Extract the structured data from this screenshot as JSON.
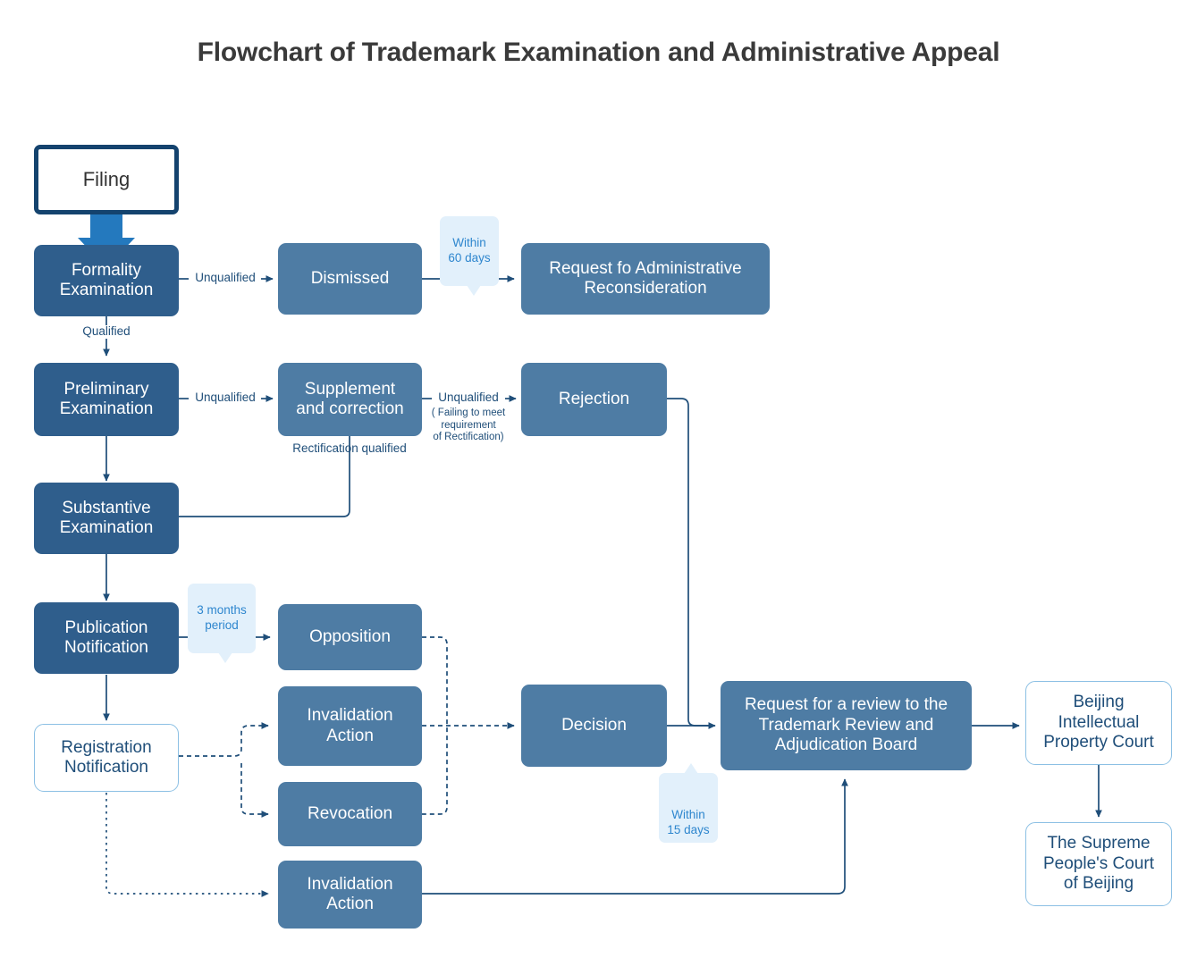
{
  "page": {
    "title": "Flowchart of Trademark Examination and Administrative Appeal",
    "background_color": "#FFFFFF"
  },
  "colors": {
    "dark_box": "#2F5E8C",
    "mid_box": "#4E7CA4",
    "outline_box_border": "#8CC0E4",
    "start_box_border": "#14436E",
    "bubble_bg": "#E2F0FB",
    "bubble_text": "#2E86CE",
    "connector": "#1F4E79",
    "thick_arrow": "#2479BE",
    "title_text": "#3A3A3A"
  },
  "nodes": {
    "filing": "Filing",
    "formality_examination": "Formality\nExamination",
    "dismissed": "Dismissed",
    "request_administrative_reconsideration": "Request fo Administrative\nReconsideration",
    "preliminary_examination": "Preliminary\nExamination",
    "supplement_and_correction": "Supplement\nand correction",
    "rejection": "Rejection",
    "substantive_examination": "Substantive\nExamination",
    "publication_notification": "Publication\nNotification",
    "opposition": "Opposition",
    "registration_notification": "Registration\nNotification",
    "invalidation_action_upper": "Invalidation\nAction",
    "revocation": "Revocation",
    "invalidation_action_lower": "Invalidation\nAction",
    "decision": "Decision",
    "request_review_trab": "Request for a review to the\nTrademark Review and\nAdjudication Board",
    "beijing_ip_court": "Beijing\nIntellectual\nProperty Court",
    "supreme_peoples_court": "The Supreme\nPeople's Court\nof Beijing"
  },
  "edge_labels": {
    "unqualified_formality": "Unqualified",
    "qualified_formality": "Qualified",
    "unqualified_preliminary": "Unqualified",
    "unqualified_supplement": "Unqualified",
    "failing_requirement": "( Failing to meet\nrequirement\nof Rectification)",
    "rectification_qualified": "Rectification qualified"
  },
  "callouts": {
    "within_60_days": "Within\n60 days",
    "three_months_period": "3 months\nperiod",
    "within_15_days": "Within\n15 days"
  }
}
